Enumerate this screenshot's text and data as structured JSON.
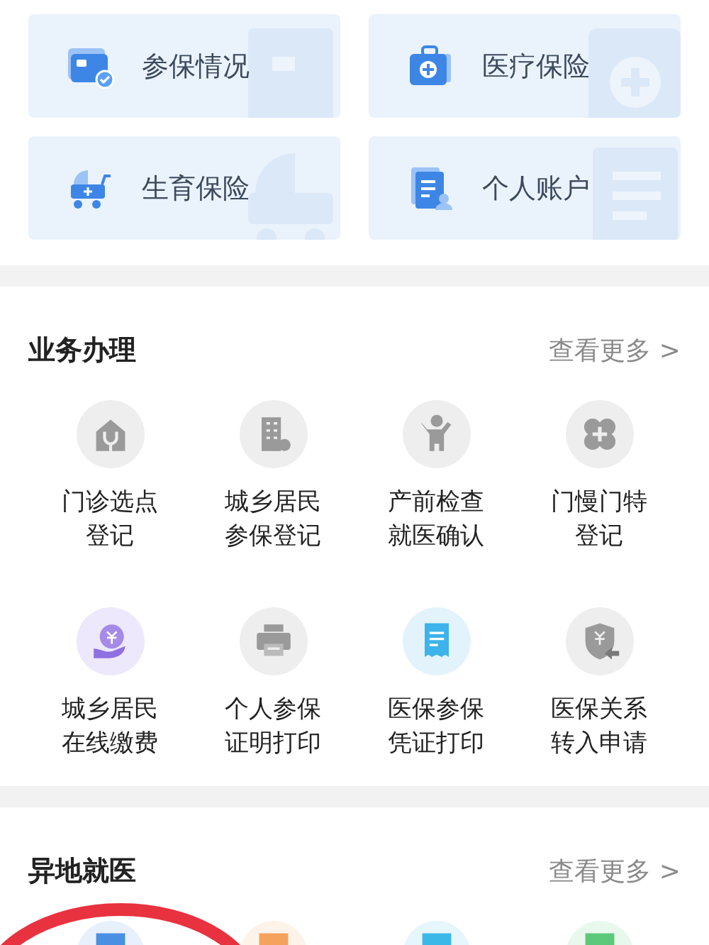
{
  "quick_cards": [
    {
      "label": "参保情况"
    },
    {
      "label": "医疗保险"
    },
    {
      "label": "生育保险"
    },
    {
      "label": "个人账户"
    }
  ],
  "sections": [
    {
      "title": "业务办理",
      "more": "查看更多 >",
      "items": [
        {
          "label": "门诊选点登记"
        },
        {
          "label": "城乡居民参保登记"
        },
        {
          "label": "产前检查就医确认"
        },
        {
          "label": "门慢门特登记"
        },
        {
          "label": "城乡居民在线缴费"
        },
        {
          "label": "个人参保证明打印"
        },
        {
          "label": "医保参保凭证打印"
        },
        {
          "label": "医保关系转入申请"
        }
      ]
    },
    {
      "title": "异地就医",
      "more": "查看更多 >",
      "items": [
        {
          "color": "#4a90e2"
        },
        {
          "color": "#f5a25d"
        },
        {
          "color": "#3cb8e8"
        },
        {
          "color": "#5cc97a"
        }
      ]
    }
  ]
}
